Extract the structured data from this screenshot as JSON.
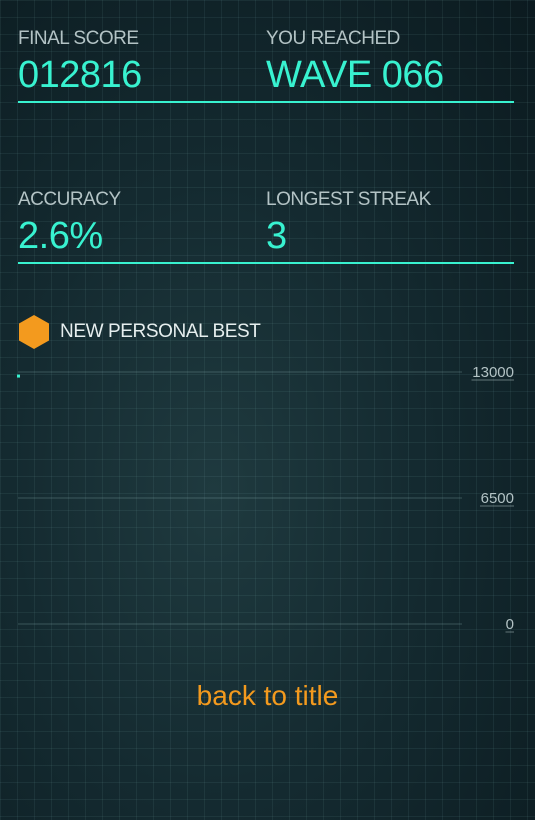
{
  "stats": {
    "final_score_label": "FINAL SCORE",
    "final_score_value": "012816",
    "wave_label": "YOU REACHED",
    "wave_value": "WAVE 066",
    "accuracy_label": "ACCURACY",
    "accuracy_value": "2.6%",
    "streak_label": "LONGEST STREAK",
    "streak_value": "3"
  },
  "personal_best": {
    "text": "NEW PERSONAL BEST",
    "icon": "hexagon-icon",
    "color": "#f39a1e"
  },
  "chart_data": {
    "type": "scatter",
    "ylim": [
      0,
      13000
    ],
    "ticks": [
      "13000",
      "6500",
      "0"
    ],
    "points": [
      {
        "x": 0,
        "y": 12816
      }
    ]
  },
  "back_button": {
    "label": "back to title"
  },
  "colors": {
    "accent": "#38f2d0",
    "orange": "#f39a1e"
  }
}
